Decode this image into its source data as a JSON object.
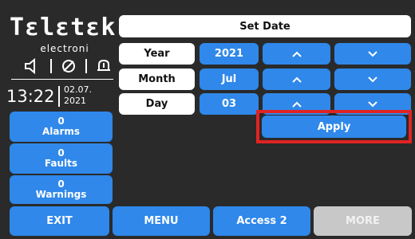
{
  "brand": {
    "logo": "Tɛlɛtɛk",
    "sub": "electroni"
  },
  "clock": {
    "time": "13:22",
    "date_line1": "02.07.",
    "date_line2": "2021"
  },
  "status": [
    {
      "count": "0",
      "label": "Alarms"
    },
    {
      "count": "0",
      "label": "Faults"
    },
    {
      "count": "0",
      "label": "Warnings"
    }
  ],
  "set_date": {
    "title": "Set Date",
    "rows": [
      {
        "label": "Year",
        "value": "2021"
      },
      {
        "label": "Month",
        "value": "Jul"
      },
      {
        "label": "Day",
        "value": "03"
      }
    ],
    "apply_label": "Apply"
  },
  "footer": {
    "exit": "EXIT",
    "menu": "MENU",
    "access": "Access 2",
    "more": "MORE"
  },
  "colors": {
    "background": "#2a2a2a",
    "button": "#2f88ea",
    "highlight": "#e02323",
    "disabled": "#c8c8c8"
  }
}
